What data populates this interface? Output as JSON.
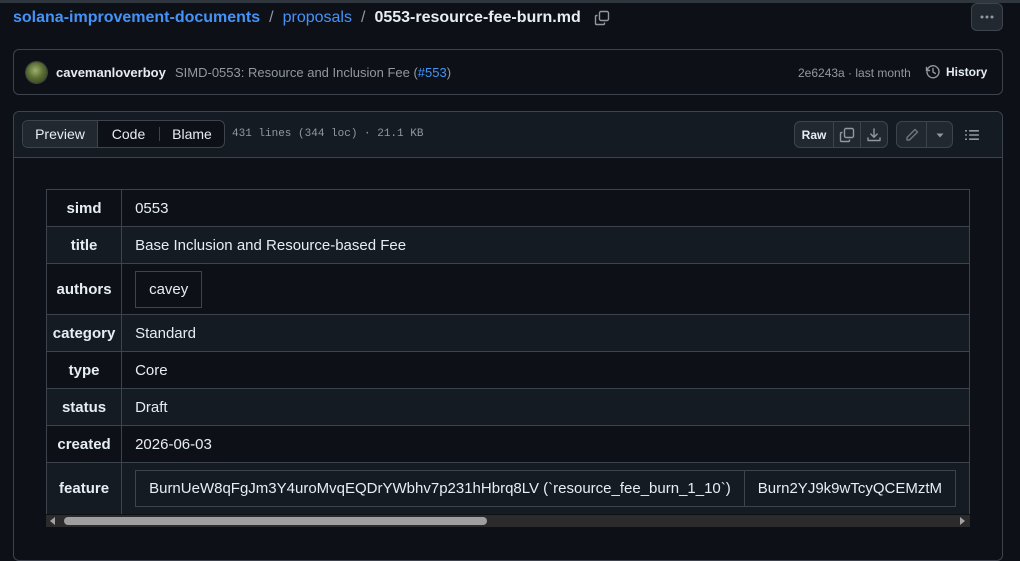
{
  "breadcrumb": {
    "repo": "solana-improvement-documents",
    "sep1": "/",
    "folder": "proposals",
    "sep2": "/",
    "file": "0553-resource-fee-burn.md",
    "copy_icon": "copy-icon"
  },
  "more_menu_icon": "kebab-horizontal-icon",
  "commit": {
    "author": "cavemanloverboy",
    "message_prefix": "SIMD-0553: Resource and Inclusion Fee (",
    "pr_link": "#553",
    "message_suffix": ")",
    "meta": "2e6243a · last month",
    "history_label": "History"
  },
  "file_header": {
    "tabs": [
      "Preview",
      "Code",
      "Blame"
    ],
    "active_tab": "Preview",
    "info": "431 lines (344 loc) · 21.1 KB",
    "raw_label": "Raw",
    "icons": [
      "copy-icon",
      "download-icon",
      "pencil-icon",
      "triangle-down-icon",
      "list-unordered-icon"
    ]
  },
  "metadata": {
    "rows": [
      {
        "key": "simd",
        "value": "0553"
      },
      {
        "key": "title",
        "value": "Base Inclusion and Resource-based Fee"
      },
      {
        "key": "authors",
        "value": "cavey"
      },
      {
        "key": "category",
        "value": "Standard"
      },
      {
        "key": "type",
        "value": "Core"
      },
      {
        "key": "status",
        "value": "Draft"
      },
      {
        "key": "created",
        "value": "2026-06-03"
      },
      {
        "key": "feature",
        "values": [
          "BurnUeW8qFgJm3Y4uroMvqEQDrYWbhv7p231hHbrq8LV (`resource_fee_burn_1_10`)",
          "Burn2YJ9k9wTcyQCEMztM"
        ]
      }
    ]
  },
  "colors": {
    "background": "#0d1117",
    "link": "#4493f8",
    "border": "#3d444d",
    "muted": "#9198a1"
  }
}
